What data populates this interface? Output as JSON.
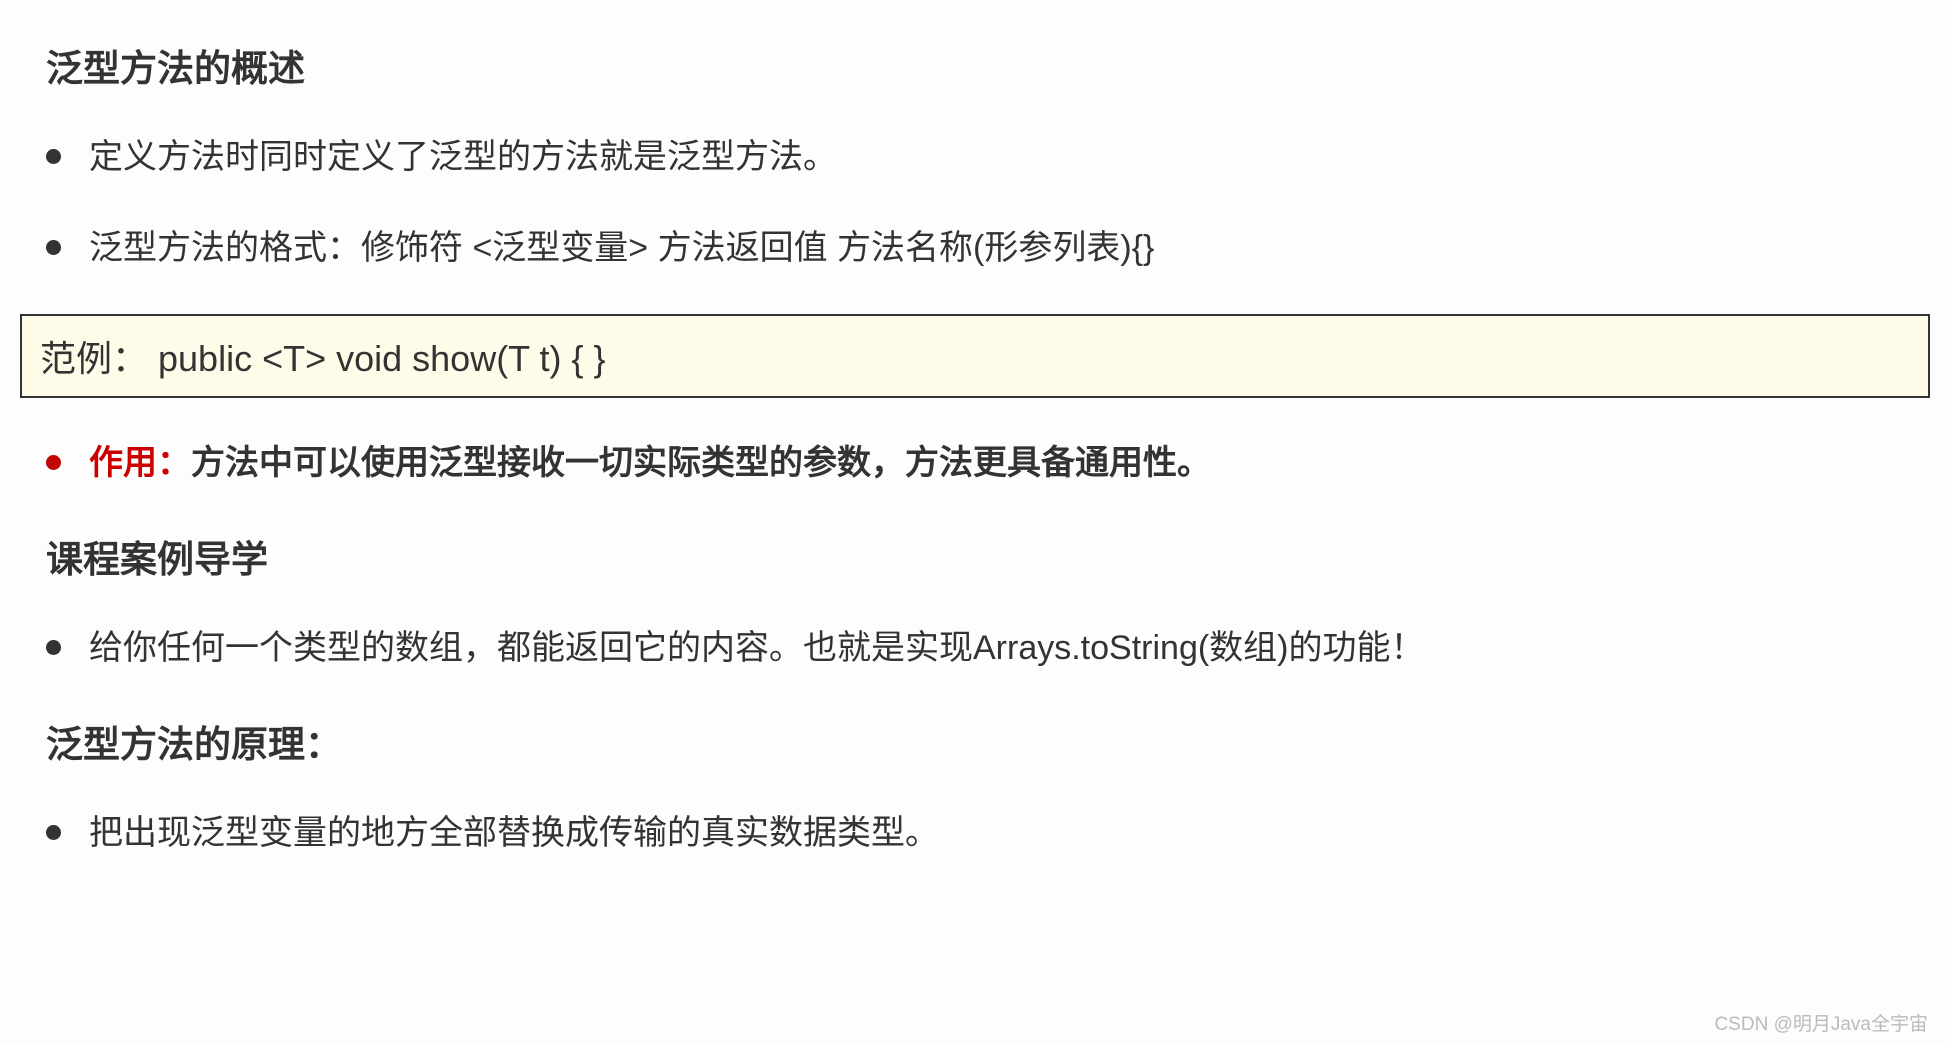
{
  "section1": {
    "heading": "泛型方法的概述",
    "bullet1": "定义方法时同时定义了泛型的方法就是泛型方法。",
    "bullet2": "泛型方法的格式：修饰符 <泛型变量> 方法返回值 方法名称(形参列表){}",
    "example": "范例： public <T> void show(T t) { }",
    "bullet3_label": "作用：",
    "bullet3_text": "方法中可以使用泛型接收一切实际类型的参数，方法更具备通用性。"
  },
  "section2": {
    "heading": "课程案例导学",
    "bullet1": "给你任何一个类型的数组，都能返回它的内容。也就是实现Arrays.toString(数组)的功能！"
  },
  "section3": {
    "heading": "泛型方法的原理：",
    "bullet1": "把出现泛型变量的地方全部替换成传输的真实数据类型。"
  },
  "watermark": "CSDN @明月Java全宇宙"
}
